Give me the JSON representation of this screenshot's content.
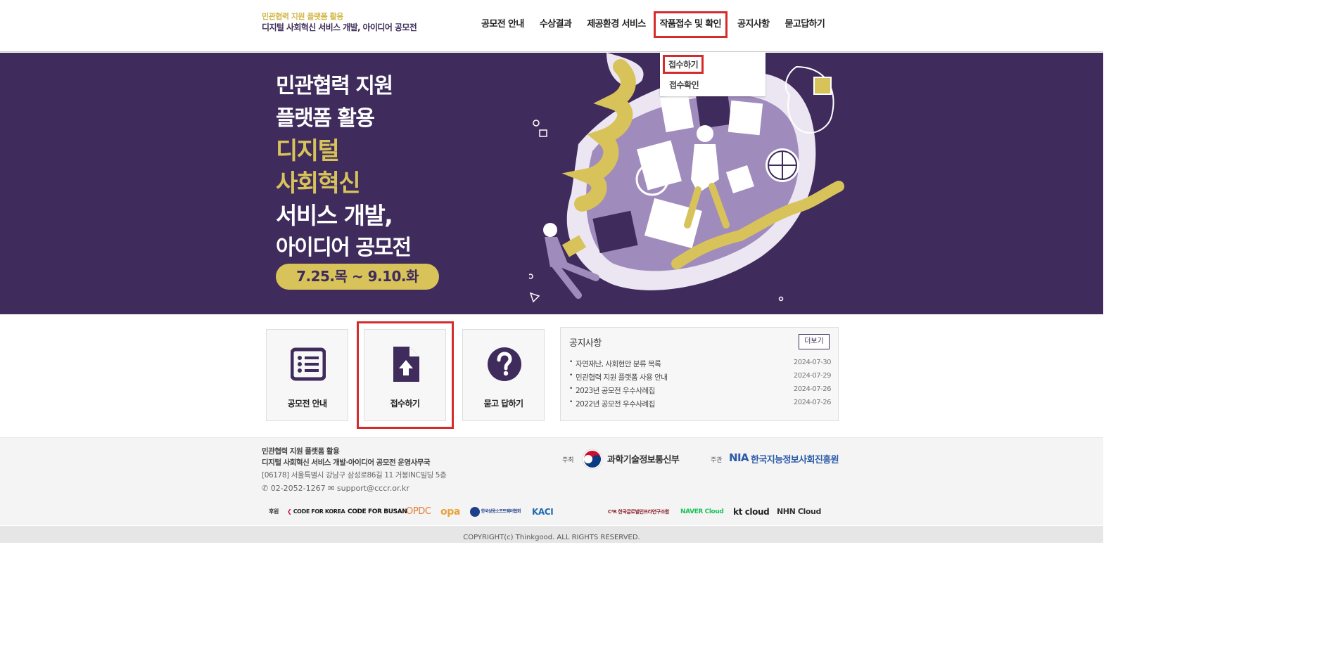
{
  "header": {
    "logo_sub": "민관협력 지원 플랫폼 활용",
    "logo_main": "디지털 사회혁신 서비스 개발, 아이디어 공모전",
    "nav": [
      {
        "label": "공모전 안내"
      },
      {
        "label": "수상결과"
      },
      {
        "label": "제공환경 서비스"
      },
      {
        "label": "작품접수 및 확인"
      },
      {
        "label": "공지사항"
      },
      {
        "label": "묻고답하기"
      }
    ],
    "dropdown": [
      {
        "label": "접수하기"
      },
      {
        "label": "접수확인"
      }
    ]
  },
  "hero": {
    "line1": "민관협력 지원",
    "line2": "플랫폼 활용",
    "line3": "디지털",
    "line4": "사회혁신",
    "line5": "서비스 개발,",
    "line6": "아이디어 공모전",
    "date": "7.25.목 ~ 9.10.화",
    "colors": {
      "bg": "#3f2b5c",
      "gold": "#d8c35a",
      "lavender": "#a08bbd"
    }
  },
  "quick_links": [
    {
      "label": "공모전 안내",
      "icon": "list-icon"
    },
    {
      "label": "접수하기",
      "icon": "file-upload-icon"
    },
    {
      "label": "묻고 답하기",
      "icon": "question-circle-icon"
    }
  ],
  "notice": {
    "title": "공지사항",
    "more": "더보기",
    "items": [
      {
        "title": "자연재난, 사회현안 분류 목록",
        "date": "2024-07-30"
      },
      {
        "title": "민관협력 지원 플랫폼 사용 안내",
        "date": "2024-07-29"
      },
      {
        "title": "2023년 공모전 우수사례집",
        "date": "2024-07-26"
      },
      {
        "title": "2022년 공모전 우수사례집",
        "date": "2024-07-26"
      }
    ]
  },
  "footer": {
    "org_line1": "민관협력 지원 플랫폼 활용",
    "org_line2": "디지털 사회혁신 서비스 개발·아이디어 공모전 운영사무국",
    "address": "[06178] 서울특별시 강남구 삼성로86길 11 거봉INC빌딩 5층",
    "phone": "02-2052-1267",
    "email": "support@cccr.or.kr",
    "host_label": "주최",
    "host_name": "과학기술정보통신부",
    "organizer_label": "주관",
    "organizer_abbr": "NIA",
    "organizer_name": "한국지능정보사회진흥원",
    "sponsor_label": "후원",
    "sponsors": [
      "CODE FOR KOREA",
      "CODE FOR BUSAN",
      "OPDC",
      "opa",
      "한국상용소프트웨어협회",
      "KACI",
      "C²R 한국글로벌인프라연구조합",
      "NAVER Cloud",
      "kt cloud",
      "NHN Cloud"
    ]
  },
  "copyright": "COPYRIGHT(c) Thinkgood. ALL RIGHTS RESERVED."
}
